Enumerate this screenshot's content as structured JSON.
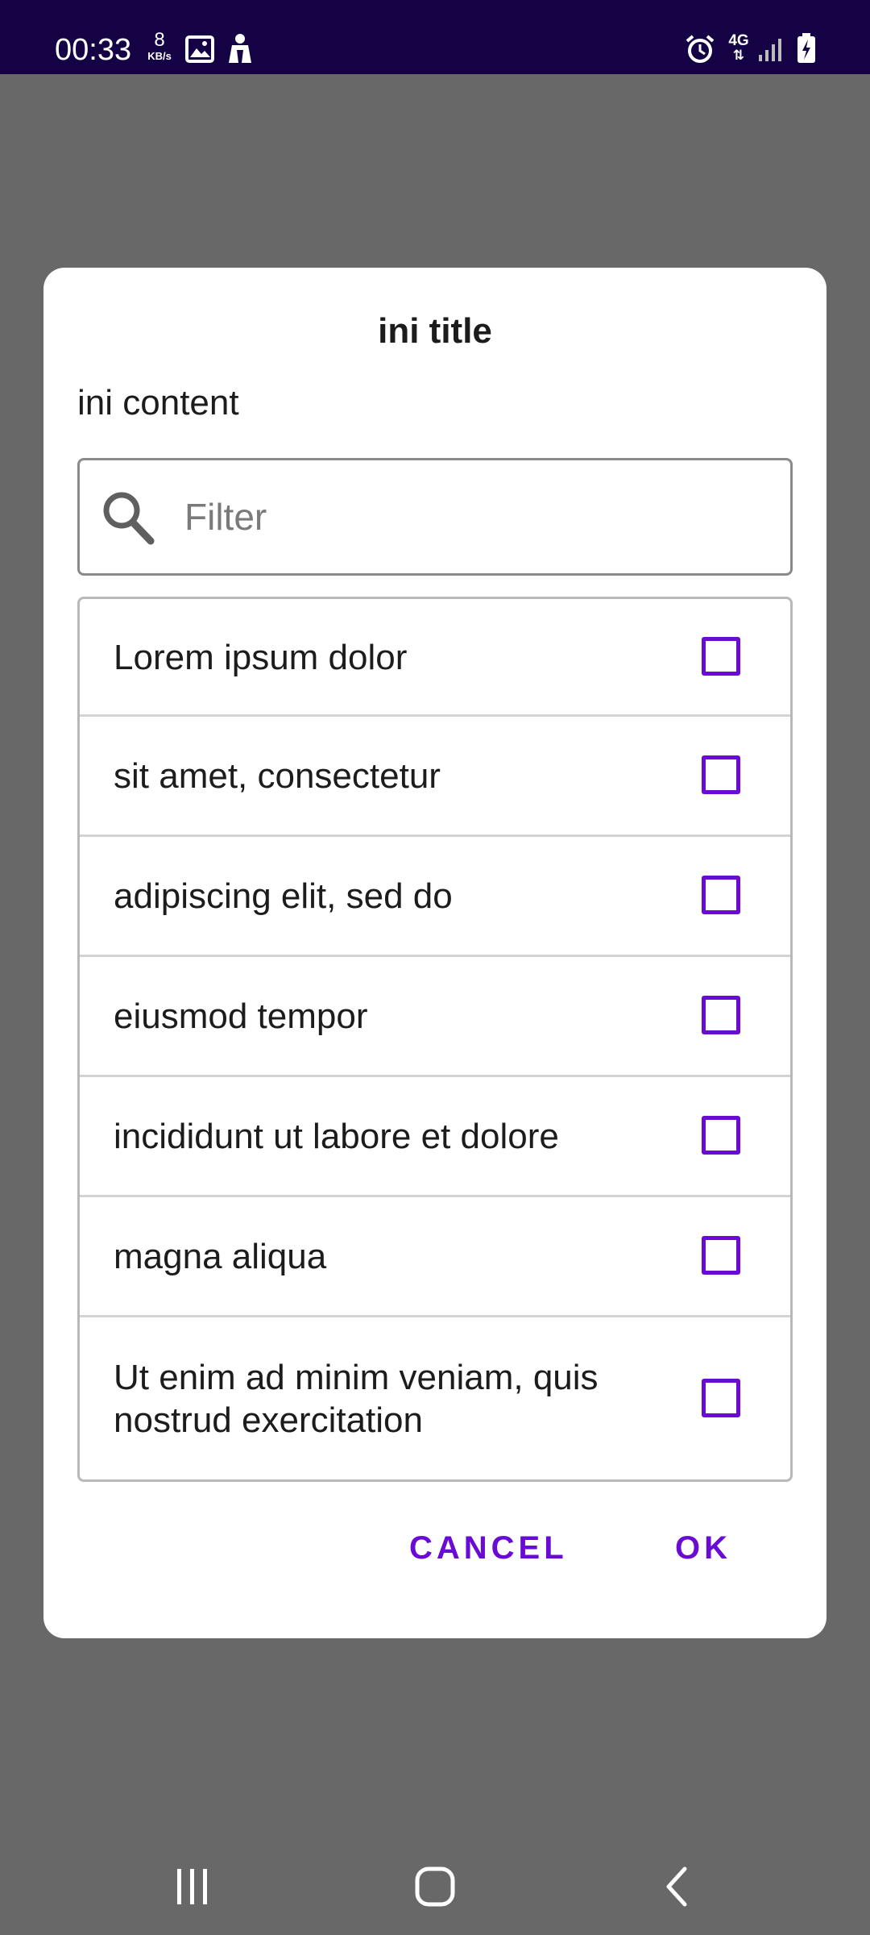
{
  "status_bar": {
    "time": "00:33",
    "data_rate_value": "8",
    "data_rate_unit": "KB/s",
    "network": "4G",
    "icons": [
      "gallery-icon",
      "user-silhouette-icon",
      "alarm-icon",
      "4g-data-icon",
      "signal-icon",
      "battery-charging-icon"
    ]
  },
  "dialog": {
    "title": "ini title",
    "content": "ini content",
    "filter": {
      "placeholder": "Filter",
      "value": ""
    },
    "items": [
      {
        "label": "Lorem ipsum dolor",
        "checked": false
      },
      {
        "label": "sit amet, consectetur",
        "checked": false
      },
      {
        "label": "adipiscing elit, sed do",
        "checked": false
      },
      {
        "label": "eiusmod tempor",
        "checked": false
      },
      {
        "label": "incididunt ut labore et dolore",
        "checked": false
      },
      {
        "label": "magna aliqua",
        "checked": false
      },
      {
        "label": "Ut enim ad minim veniam, quis nostrud exercitation",
        "checked": false
      }
    ],
    "cancel_label": "CANCEL",
    "ok_label": "OK"
  },
  "nav_bar": {
    "icons": [
      "recent-apps-icon",
      "home-icon",
      "back-icon"
    ]
  },
  "colors": {
    "status_bar": "#150245",
    "scrim": "#686868",
    "accent": "#6a0bd5",
    "dialog_bg": "#ffffff"
  }
}
